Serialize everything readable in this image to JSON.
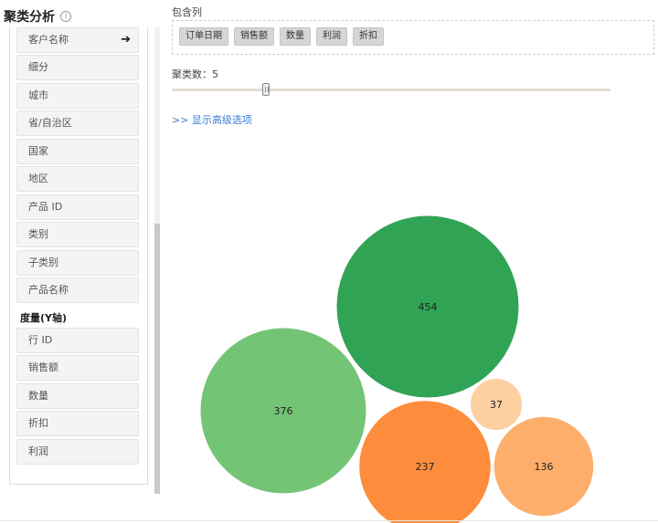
{
  "title": "聚类分析",
  "dimension_fields": [
    {
      "label": "客户名称",
      "selected": true
    },
    {
      "label": "细分"
    },
    {
      "label": "城市"
    },
    {
      "label": "省/自治区"
    },
    {
      "label": "国家"
    },
    {
      "label": "地区"
    },
    {
      "label": "产品 ID"
    },
    {
      "label": "类别"
    },
    {
      "label": "子类别"
    },
    {
      "label": "产品名称"
    }
  ],
  "measure_section_title": "度量(Y轴)",
  "measure_fields": [
    {
      "label": "行 ID"
    },
    {
      "label": "销售额"
    },
    {
      "label": "数量"
    },
    {
      "label": "折扣"
    },
    {
      "label": "利润"
    }
  ],
  "include_label": "包含列",
  "included_columns": [
    "订单日期",
    "销售额",
    "数量",
    "利润",
    "折扣"
  ],
  "cluster_count_label": "聚类数：5",
  "cluster_count": 5,
  "advanced_link": ">> 显示高级选项",
  "chart_data": {
    "type": "bubble",
    "title": "",
    "bubbles": [
      {
        "label": "454",
        "value": 454,
        "color": "#31a354"
      },
      {
        "label": "376",
        "value": 376,
        "color": "#74c476"
      },
      {
        "label": "237",
        "value": 237,
        "color": "#fd8d3c"
      },
      {
        "label": "136",
        "value": 136,
        "color": "#fdae6b"
      },
      {
        "label": "37",
        "value": 37,
        "color": "#fdd0a2"
      }
    ]
  }
}
